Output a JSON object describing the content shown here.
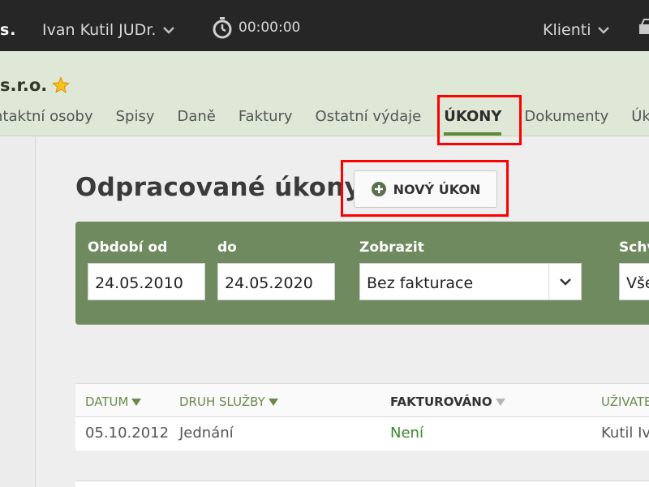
{
  "topbar": {
    "brand": "s.",
    "user_name": "Ivan Kutil JUDr.",
    "timer": "00:00:00",
    "clients_label": "Klienti",
    "icons": [
      "chevron-down-icon",
      "stopwatch-icon",
      "cart-icon"
    ]
  },
  "client": {
    "name": "s.r.o.",
    "favorite_icon": "star-icon"
  },
  "tabs": [
    {
      "label": "ntaktní osoby"
    },
    {
      "label": "Spisy"
    },
    {
      "label": "Daně"
    },
    {
      "label": "Faktury"
    },
    {
      "label": "Ostatní výdaje"
    },
    {
      "label": "ÚKONY",
      "active": true
    },
    {
      "label": "Dokumenty"
    },
    {
      "label": "Úk"
    }
  ],
  "page": {
    "title": "Odpracované úkony",
    "new_button": "NOVÝ ÚKON"
  },
  "filter": {
    "from_label": "Období od",
    "from_value": "24.05.2010",
    "to_label": "do",
    "to_value": "24.05.2020",
    "show_label": "Zobrazit",
    "show_value": "Bez fakturace",
    "approve_label": "Schv",
    "approve_value": "Vše"
  },
  "table": {
    "columns": [
      {
        "label": "DATUM",
        "sort": "desc"
      },
      {
        "label": "DRUH SLUŽBY",
        "sort": "desc"
      },
      {
        "label": "FAKTUROVÁNO",
        "sort": "inactive"
      },
      {
        "label": "UŽIVATE"
      }
    ],
    "rows": [
      {
        "datum": "05.10.2012",
        "druh": "Jednání",
        "fakturovano": "Není",
        "uzivatel": "Kutil Iv"
      }
    ]
  },
  "colors": {
    "topbar": "#262626",
    "client_header": "#dfe7d6",
    "filter_bg": "#6e8a5e",
    "accent_green": "#5e8a3a",
    "highlight": "#ff0000"
  }
}
